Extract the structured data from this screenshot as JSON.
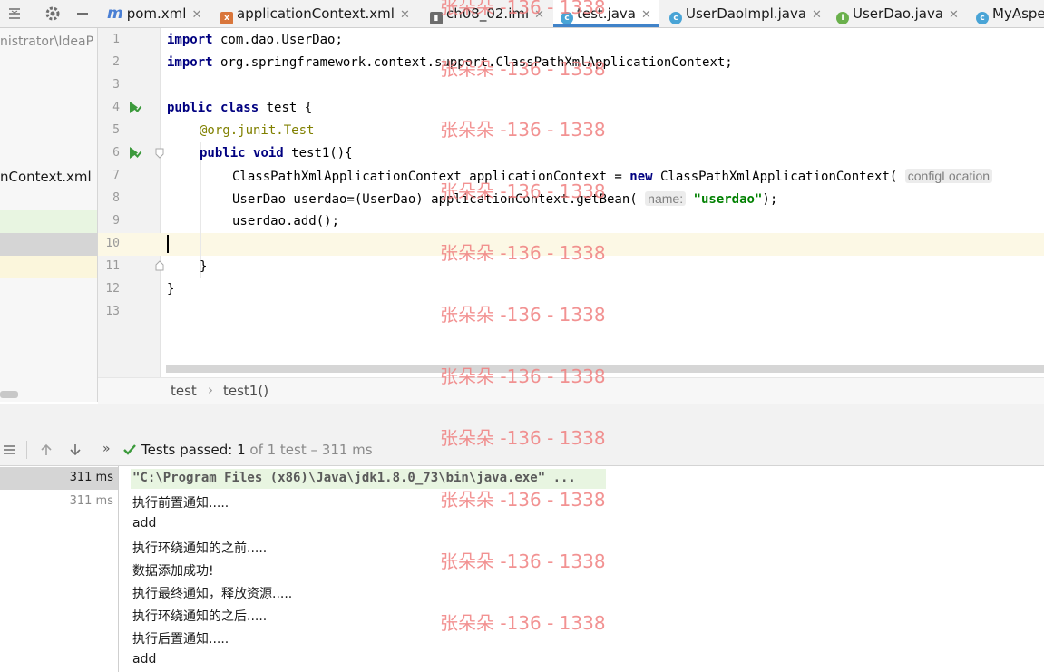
{
  "tabs": [
    {
      "label": "pom.xml",
      "icon": "maven-icon",
      "closable": true
    },
    {
      "label": "applicationContext.xml",
      "icon": "xml-file-icon",
      "closable": true
    },
    {
      "label": "ch08_02.iml",
      "icon": "module-file-icon",
      "closable": true
    },
    {
      "label": "test.java",
      "icon": "class-icon",
      "closable": true,
      "active": true
    },
    {
      "label": "UserDaoImpl.java",
      "icon": "class-icon",
      "closable": true
    },
    {
      "label": "UserDao.java",
      "icon": "interface-icon",
      "closable": true
    },
    {
      "label": "MyAspe",
      "icon": "class-icon",
      "closable": false
    }
  ],
  "project": {
    "path_fragment": "nistrator\\IdeaP",
    "file_fragment": "nContext.xml"
  },
  "editor": {
    "line_numbers": [
      "1",
      "2",
      "3",
      "4",
      "5",
      "6",
      "7",
      "8",
      "9",
      "10",
      "11",
      "12",
      "13"
    ],
    "code": {
      "l1_kw": "import",
      "l1_rest": " com.dao.UserDao;",
      "l2_kw": "import",
      "l2_rest": " org.springframework.context.support.ClassPathXmlApplicationContext;",
      "l4_kw1": "public",
      "l4_kw2": "class",
      "l4_rest": " test {",
      "l5_ann": "@org.junit.Test",
      "l6_kw1": "public",
      "l6_kw2": "void",
      "l6_rest": " test1(){",
      "l7_a": "ClassPathXmlApplicationContext applicationContext = ",
      "l7_kw": "new",
      "l7_b": " ClassPathXmlApplicationContext(",
      "l7_hint": "configLocation",
      "l8_a": "UserDao userdao=(UserDao) applicationContext.getBean(",
      "l8_hint": "name:",
      "l8_str": "\"userdao\"",
      "l8_b": ");",
      "l9": "userdao.add();",
      "l11": "}",
      "l12": "}"
    },
    "current_line": 10
  },
  "breadcrumb": {
    "items": [
      "test",
      "test1()"
    ],
    "separator": "›"
  },
  "run": {
    "status": "Tests passed:",
    "passed": "1",
    "of_total": "of 1 test",
    "duration": "– 311 ms",
    "tree_times": [
      "311 ms",
      "311 ms"
    ],
    "output": [
      "\"C:\\Program Files (x86)\\Java\\jdk1.8.0_73\\bin\\java.exe\" ...",
      "执行前置通知.....",
      "add",
      "执行环绕通知的之前.....",
      "数据添加成功!",
      "执行最终通知，释放资源.....",
      "执行环绕通知的之后.....",
      "执行后置通知.....",
      "add"
    ]
  },
  "watermark": {
    "text": "张朵朵 -136 - 1338",
    "color": "#f08080"
  },
  "colors": {
    "keyword": "#000080",
    "annotation": "#808000",
    "string": "#008000",
    "accent": "#4083c9",
    "pass": "#3c9a3c"
  }
}
